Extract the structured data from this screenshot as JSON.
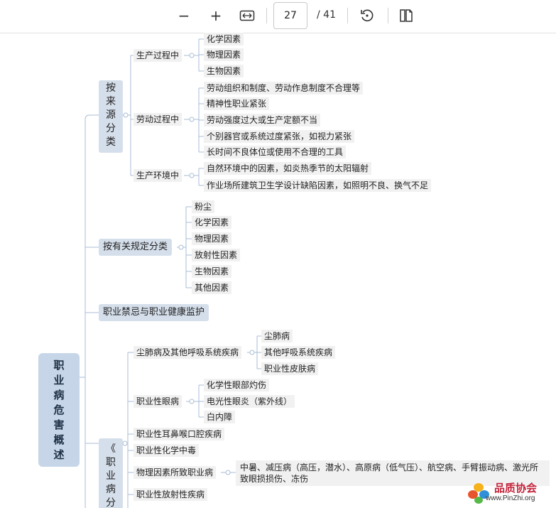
{
  "toolbar": {
    "zoom_out": "−",
    "zoom_in": "+",
    "page_current": "27",
    "page_total": "/ 41"
  },
  "mindmap": {
    "root": [
      "职",
      "业",
      "病",
      "危",
      "害",
      "概",
      "述"
    ],
    "source": {
      "label": [
        "按",
        "来",
        "源",
        "分",
        "类"
      ],
      "production_process": {
        "label": "生产过程中",
        "items": [
          "化学因素",
          "物理因素",
          "生物因素"
        ]
      },
      "labor_process": {
        "label": "劳动过程中",
        "items": [
          "劳动组织和制度、劳动作息制度不合理等",
          "精神性职业紧张",
          "劳动强度过大或生产定额不当",
          "个别器官或系统过度紧张，如视力紧张",
          "长时间不良体位或使用不合理的工具"
        ]
      },
      "environment": {
        "label": "生产环境中",
        "items": [
          "自然环境中的因素，如炎热季节的太阳辐射",
          "作业场所建筑卫生学设计缺陷因素，如照明不良、换气不足"
        ]
      }
    },
    "regulation": {
      "label": "按有关规定分类",
      "items": [
        "粉尘",
        "化学因素",
        "物理因素",
        "放射性因素",
        "生物因素",
        "其他因素"
      ]
    },
    "taboo": {
      "label": "职业禁忌与职业健康监护"
    },
    "catalog": {
      "label": [
        "《",
        "职",
        "业",
        "病",
        "分"
      ],
      "pneumoconiosis": {
        "label": "尘肺病及其他呼吸系统疾病",
        "items": [
          "尘肺病",
          "其他呼吸系统疾病",
          "职业性皮肤病"
        ]
      },
      "eye": {
        "label": "职业性眼病",
        "items": [
          "化学性眼部灼伤",
          "电光性眼炎（紫外线）",
          "白内障"
        ]
      },
      "ent": "职业性耳鼻喉口腔疾病",
      "poisoning": "职业性化学中毒",
      "physical": {
        "label": "物理因素所致职业病",
        "detail": "中暑、减压病（高压，潜水）、高原病（低气压）、航空病、手臂振动病、激光所致眼损损伤、冻伤"
      },
      "radiation": "职业性放射性疾病"
    }
  },
  "watermark": {
    "name": "品质协会",
    "url": "www.PinZhi.org"
  },
  "colors": {
    "root": "#c6d6e8",
    "level1": "#d5dfeb",
    "leaf": "#f1f1f1",
    "line": "#a8bdd4"
  }
}
